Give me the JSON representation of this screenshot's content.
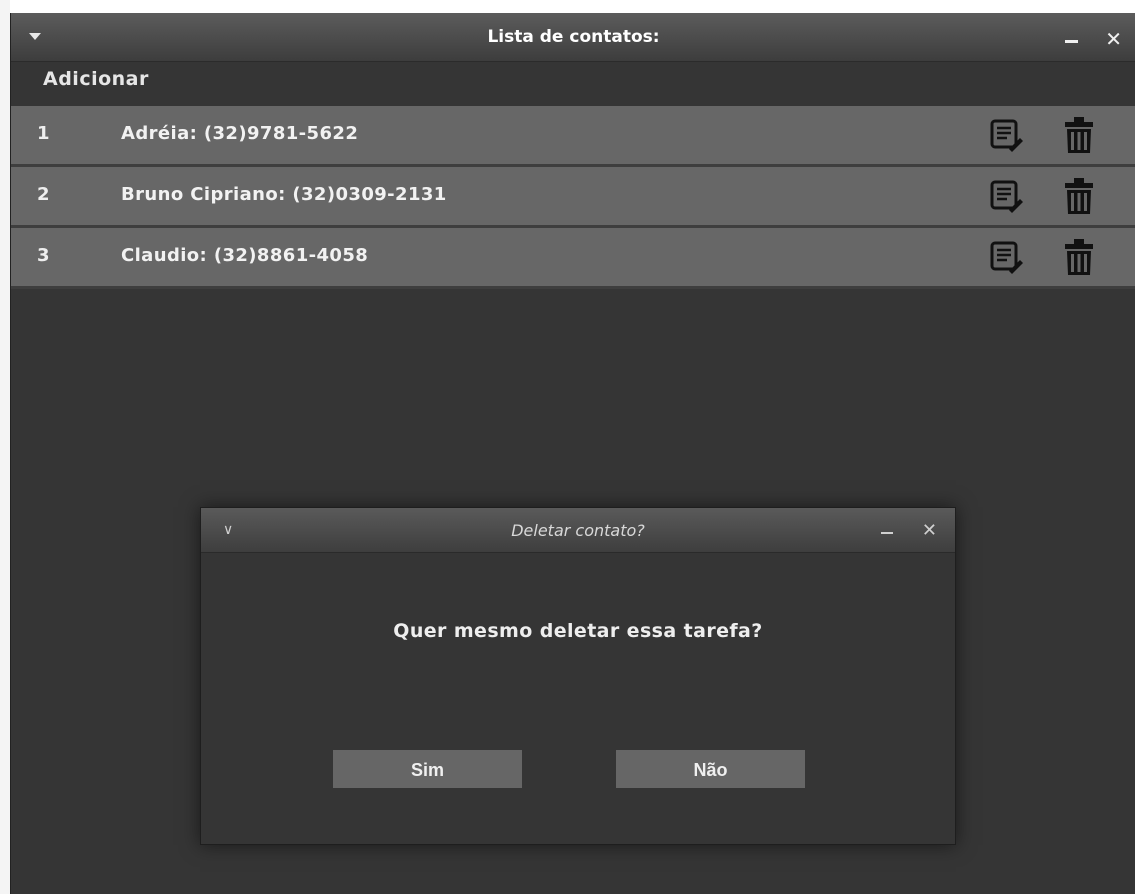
{
  "window": {
    "title": "Lista de contatos:",
    "add_label": "Adicionar"
  },
  "contacts": [
    {
      "index": "1",
      "text": "Adréia: (32)9781-5622"
    },
    {
      "index": "2",
      "text": "Bruno Cipriano: (32)0309-2131"
    },
    {
      "index": "3",
      "text": "Claudio: (32)8861-4058"
    }
  ],
  "row_icons": {
    "edit": "edit-note-icon",
    "delete": "trash-icon"
  },
  "dialog": {
    "title": "Deletar contato?",
    "message": "Quer mesmo deletar essa tarefa?",
    "yes_label": "Sim",
    "no_label": "Não"
  },
  "colors": {
    "window_bg": "#353535",
    "row_bg": "#676767",
    "button_bg": "#666666",
    "text": "#f2f2f2"
  }
}
